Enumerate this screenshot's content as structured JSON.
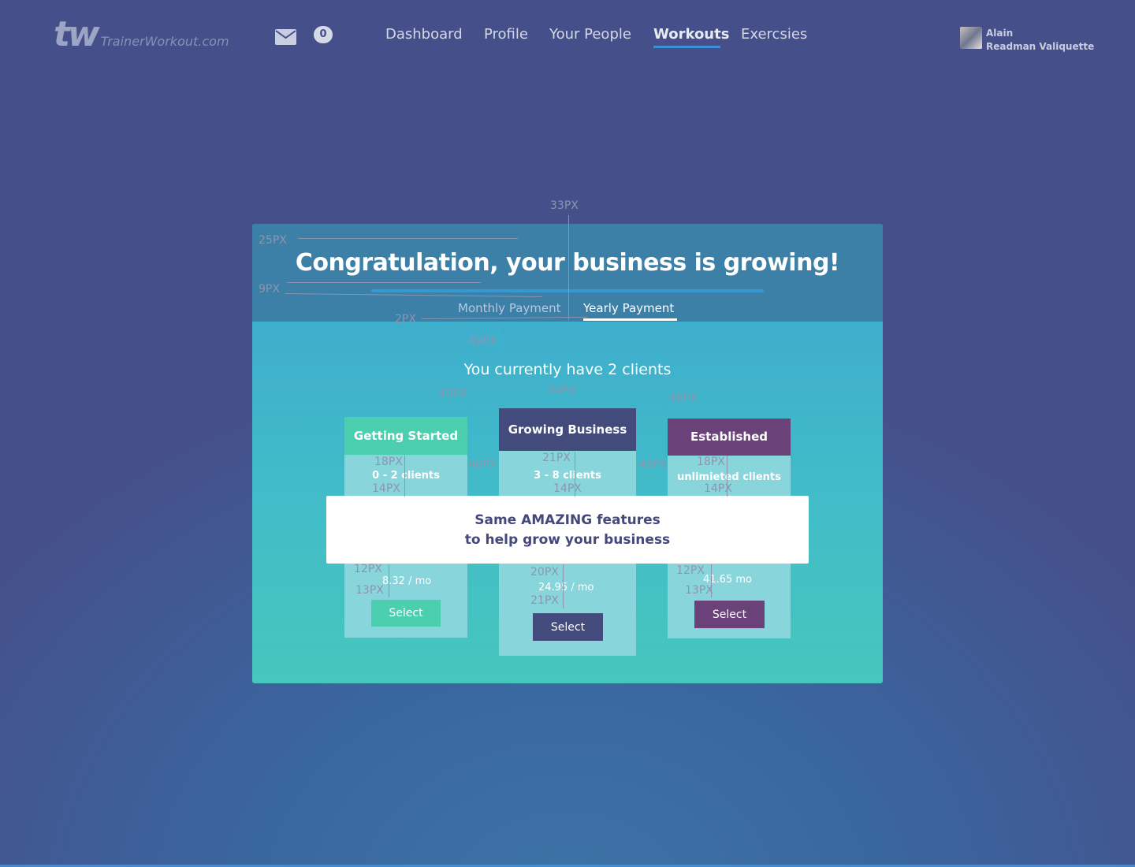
{
  "header": {
    "logo_mark": "tw",
    "logo_text": "TrainerWorkout.com",
    "message_count": "0",
    "nav": [
      "Dashboard",
      "Profile",
      "Your People",
      "Workouts",
      "Exercsies"
    ],
    "active_nav": "Workouts",
    "user_first": "Alain",
    "user_last": "Readman Valiquette"
  },
  "modal": {
    "title": "Congratulation, your business is growing!",
    "tabs": [
      "Monthly Payment",
      "Yearly Payment"
    ],
    "active_tab": "Yearly Payment",
    "clients_line": "You currently have 2 clients",
    "plans": [
      {
        "name": "Getting Started",
        "clients": "0 - 2 clients",
        "price": "8.32 / mo",
        "button": "Select",
        "color": "#4ccfae"
      },
      {
        "name": "Growing Business",
        "clients": "3 - 8 clients",
        "price": "24.95 / mo",
        "button": "Select",
        "color": "#434b7c"
      },
      {
        "name": "Established",
        "clients": "unlimieted clients",
        "price": "41.65  mo",
        "button": "Select",
        "color": "#6a4178"
      }
    ],
    "features_line1": "Same AMAZING features",
    "features_line2": "to help grow your business"
  },
  "annotations": {
    "a1": "33PX",
    "a2": "25PX",
    "a3": "9PX",
    "a4": "2PX",
    "a5": "49PX",
    "a6": "40PX",
    "a7": "34PX",
    "a8": "46PX",
    "a9": "18PX",
    "a10": "14PX",
    "a11": "40PX",
    "a12": "21PX",
    "a13": "14PX",
    "a14": "40PX",
    "a15": "18PX",
    "a16": "14PX",
    "a17": "12PX",
    "a18": "13PX",
    "a19": "20PX",
    "a20": "21PX",
    "a21": "12PX",
    "a22": "13PX"
  },
  "colors": {
    "background": "#45508a",
    "modal_header": "#3c80a8",
    "card": "#88d6dc",
    "accent_blue": "#3d8ed6"
  }
}
